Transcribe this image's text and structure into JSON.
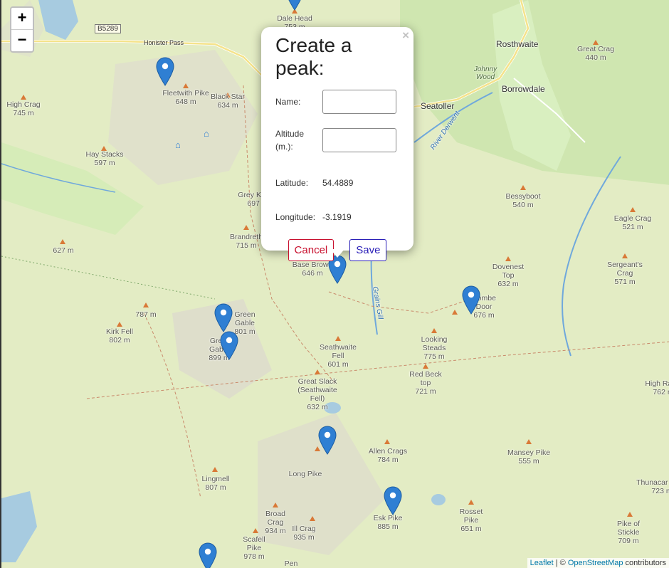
{
  "controls": {
    "zoom_in": "+",
    "zoom_out": "−"
  },
  "road": {
    "badge": "B5289",
    "pass": "Honister Pass"
  },
  "places": [
    {
      "name": "Rosthwaite",
      "kind": "village"
    },
    {
      "name": "Borrowdale",
      "kind": "village"
    },
    {
      "name": "Seatoller",
      "kind": "village"
    },
    {
      "name": "Johnny Wood",
      "kind": "wood"
    },
    {
      "name": "River Derwent",
      "kind": "water"
    },
    {
      "name": "Grains Gill",
      "kind": "water"
    }
  ],
  "peaks": [
    {
      "name": "Dale Head",
      "alt": "753 m"
    },
    {
      "name": "Fleetwith Pike",
      "alt": "648 m"
    },
    {
      "name": "Black Star",
      "alt": "634 m"
    },
    {
      "name": "High Crag",
      "alt": "745 m"
    },
    {
      "name": "Hay Stacks",
      "alt": "597 m"
    },
    {
      "name": "Grey Knotts",
      "alt": "697 m"
    },
    {
      "name": "Brandreth",
      "alt": "715 m"
    },
    {
      "name": "",
      "alt": "627 m"
    },
    {
      "name": "Base Brown",
      "alt": "646 m"
    },
    {
      "name": "Great Crag",
      "alt": "440 m"
    },
    {
      "name": "Bessyboot",
      "alt": "540 m"
    },
    {
      "name": "Eagle Crag",
      "alt": "521 m"
    },
    {
      "name": "Sergeant's Crag",
      "alt": "571 m"
    },
    {
      "name": "Dovenest Top",
      "alt": "632 m"
    },
    {
      "name": "Combe Door",
      "alt": "676 m"
    },
    {
      "name": "",
      "alt": "787 m"
    },
    {
      "name": "Kirk Fell",
      "alt": "802 m"
    },
    {
      "name": "Green Gable",
      "alt": "801 m"
    },
    {
      "name": "Great Gable",
      "alt": "899 m"
    },
    {
      "name": "Seathwaite Fell",
      "alt": "601 m"
    },
    {
      "name": "Looking Steads",
      "alt": "775 m"
    },
    {
      "name": "Red Beck top",
      "alt": "721 m"
    },
    {
      "name": "Great Slack (Seathwaite Fell)",
      "alt": "632 m"
    },
    {
      "name": "High Raise",
      "alt": "762 m"
    },
    {
      "name": "Allen Crags",
      "alt": "784 m"
    },
    {
      "name": "Long Pike",
      "alt": ""
    },
    {
      "name": "Rosset Pike",
      "alt": "651 m"
    },
    {
      "name": "Lingmell",
      "alt": "807 m"
    },
    {
      "name": "Esk Pike",
      "alt": "885 m"
    },
    {
      "name": "Pike of Stickle",
      "alt": "709 m"
    },
    {
      "name": "Broad Crag",
      "alt": "934 m"
    },
    {
      "name": "Ill Crag",
      "alt": "935 m"
    },
    {
      "name": "Scafell Pike",
      "alt": "978 m"
    },
    {
      "name": "Mansey Pike",
      "alt": "555 m"
    },
    {
      "name": "Thunacar Knott",
      "alt": "723 m"
    },
    {
      "name": "Pen",
      "alt": ""
    }
  ],
  "popup": {
    "title": "Create a peak:",
    "close": "×",
    "name_label": "Name:",
    "name_value": "",
    "altitude_label": "Altitude (m.):",
    "altitude_value": "",
    "latitude_label": "Latitude:",
    "latitude_value": "54.4889",
    "longitude_label": "Longitude:",
    "longitude_value": "-3.1919",
    "cancel_label": "Cancel",
    "save_label": "Save"
  },
  "attribution": {
    "leaflet": "Leaflet",
    "sep": " | © ",
    "osm": "OpenStreetMap",
    "suffix": " contributors"
  },
  "colors": {
    "marker": "#2f7fd3",
    "peak_triangle": "#d97937",
    "cancel": "#c8102e",
    "save": "#2a1fb7"
  }
}
